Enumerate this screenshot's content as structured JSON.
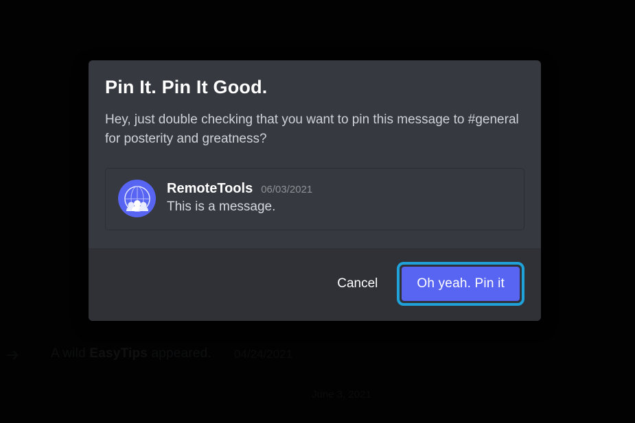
{
  "modal": {
    "title": "Pin It. Pin It Good.",
    "description": "Hey, just double checking that you want to pin this message to #general for posterity and greatness?",
    "cancel_label": "Cancel",
    "confirm_label": "Oh yeah. Pin it"
  },
  "message": {
    "author": "RemoteTools",
    "timestamp": "06/03/2021",
    "content": "This is a message."
  },
  "background": {
    "join_prefix": "A wild ",
    "join_name": "EasyTips",
    "join_suffix": " appeared.",
    "join_date": "04/24/2021",
    "divider_date": "June 3, 2021"
  }
}
